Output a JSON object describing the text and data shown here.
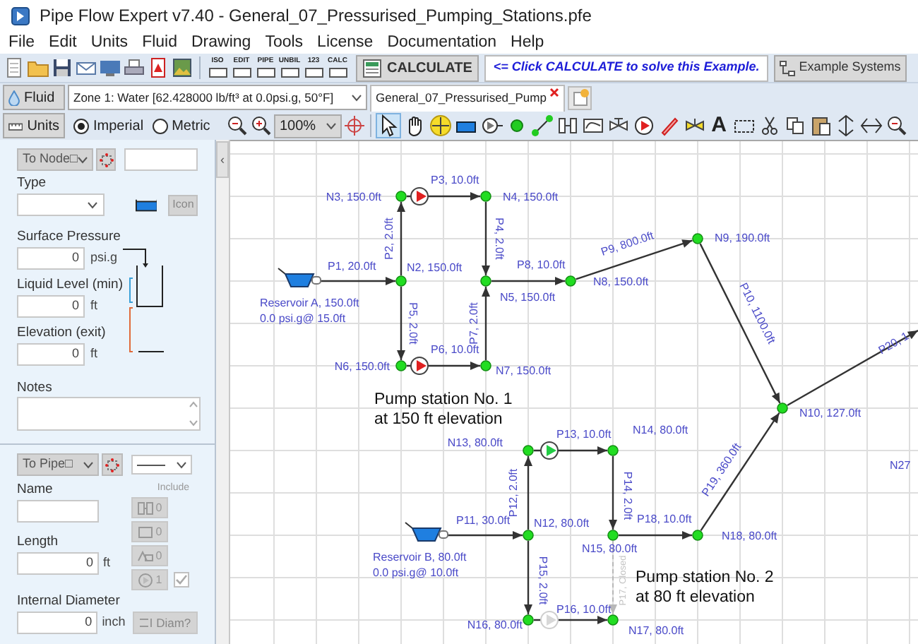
{
  "window": {
    "title": "Pipe Flow Expert v7.40 - General_07_Pressurised_Pumping_Stations.pfe"
  },
  "menu": [
    "File",
    "Edit",
    "Units",
    "Fluid",
    "Drawing",
    "Tools",
    "License",
    "Documentation",
    "Help"
  ],
  "toolbar": {
    "report_buttons": [
      "ISO",
      "EDIT",
      "PIPE",
      "UNBIL",
      "123",
      "CALC"
    ],
    "calculate": "CALCULATE",
    "hint": "<= Click CALCULATE to solve this Example.",
    "examples": "Example Systems"
  },
  "fluid_bar": {
    "button": "Fluid",
    "zone": "Zone 1: Water [62.428000 lb/ft³ at 0.0psi.g, 50°F]",
    "tabs": [
      {
        "label": "General_07_Pressurised_Pump",
        "selected": true
      }
    ]
  },
  "units_bar": {
    "button": "Units",
    "systems": [
      {
        "label": "Imperial",
        "selected": true
      },
      {
        "label": "Metric",
        "selected": false
      }
    ],
    "zoom": "100%",
    "text_tool": "A"
  },
  "node_panel": {
    "selector": "To Node□",
    "type_label": "Type",
    "icon_button": "Icon",
    "fields": [
      {
        "label": "Surface Pressure",
        "value": "0",
        "unit": "psi.g"
      },
      {
        "label": "Liquid Level (min)",
        "value": "0",
        "unit": "ft"
      },
      {
        "label": "Elevation (exit)",
        "value": "0",
        "unit": "ft"
      }
    ],
    "notes_label": "Notes"
  },
  "pipe_panel": {
    "selector": "To Pipe□",
    "name_label": "Name",
    "include_label": "Include",
    "components": [
      "0",
      "0",
      "0",
      "1"
    ],
    "include": {
      "checked": true
    },
    "length": {
      "label": "Length",
      "value": "0",
      "unit": "ft"
    },
    "diameter": {
      "label": "Internal Diameter",
      "value": "0",
      "unit": "inch"
    },
    "diam_button": "Diam?"
  },
  "collapse_button": "‹",
  "diagram": {
    "nodes": [
      {
        "label": "N3, 150.0ft"
      },
      {
        "label": "N4, 150.0ft"
      },
      {
        "label": "N2, 150.0ft"
      },
      {
        "label": "N5, 150.0ft"
      },
      {
        "label": "N8, 150.0ft"
      },
      {
        "label": "N6, 150.0ft"
      },
      {
        "label": "N7, 150.0ft"
      },
      {
        "label": "N9, 190.0ft"
      },
      {
        "label": "N10, 127.0ft"
      },
      {
        "label": "N13, 80.0ft"
      },
      {
        "label": "N14, 80.0ft"
      },
      {
        "label": "N12, 80.0ft"
      },
      {
        "label": "N15, 80.0ft"
      },
      {
        "label": "N18, 80.0ft"
      },
      {
        "label": "N16, 80.0ft"
      },
      {
        "label": "N17, 80.0ft"
      }
    ],
    "pipes": [
      {
        "label": "P1, 20.0ft",
        "closed": false
      },
      {
        "label": "P3, 10.0ft",
        "closed": false,
        "pump": {
          "color": "#e02020"
        }
      },
      {
        "label": "P2, 2.0ft",
        "closed": false
      },
      {
        "label": "P4, 2.0ft",
        "closed": false
      },
      {
        "label": "P5, 2.0ft",
        "closed": false
      },
      {
        "label": "P7, 2.0ft",
        "closed": false
      },
      {
        "label": "P6, 10.0ft",
        "closed": false,
        "pump": {
          "color": "#e02020"
        }
      },
      {
        "label": "P8, 10.0ft",
        "closed": false
      },
      {
        "label": "P9, 800.0ft",
        "closed": false
      },
      {
        "label": "P10, 1100.0ft",
        "closed": false
      },
      {
        "label": "P20, 1",
        "closed": false
      },
      {
        "label": "P11, 30.0ft",
        "closed": false
      },
      {
        "label": "P12, 2.0ft",
        "closed": false
      },
      {
        "label": "P13, 10.0ft",
        "closed": false,
        "pump": {
          "color": "#22cc44"
        }
      },
      {
        "label": "P14, 2.0ft",
        "closed": false
      },
      {
        "label": "P18, 10.0ft",
        "closed": false
      },
      {
        "label": "P19, 360.0ft",
        "closed": false
      },
      {
        "label": "P15, 2.0ft",
        "closed": false
      },
      {
        "label": "P16, 10.0ft",
        "closed": false,
        "pump": {
          "color": "#d8d8d8"
        }
      },
      {
        "label": "P17, Closed",
        "closed": true
      }
    ],
    "reservoirs": [
      {
        "lines": [
          "Reservoir A, 150.0ft",
          "0.0 psi.g@ 15.0ft"
        ]
      },
      {
        "lines": [
          "Reservoir B, 80.0ft",
          "0.0 psi.g@ 10.0ft"
        ]
      }
    ],
    "notes": [
      {
        "lines": [
          "Pump station No. 1",
          "at 150 ft elevation"
        ]
      },
      {
        "lines": [
          "Pump station No. 2",
          "at 80 ft elevation"
        ]
      }
    ],
    "edge_labels": [
      "N27"
    ]
  }
}
